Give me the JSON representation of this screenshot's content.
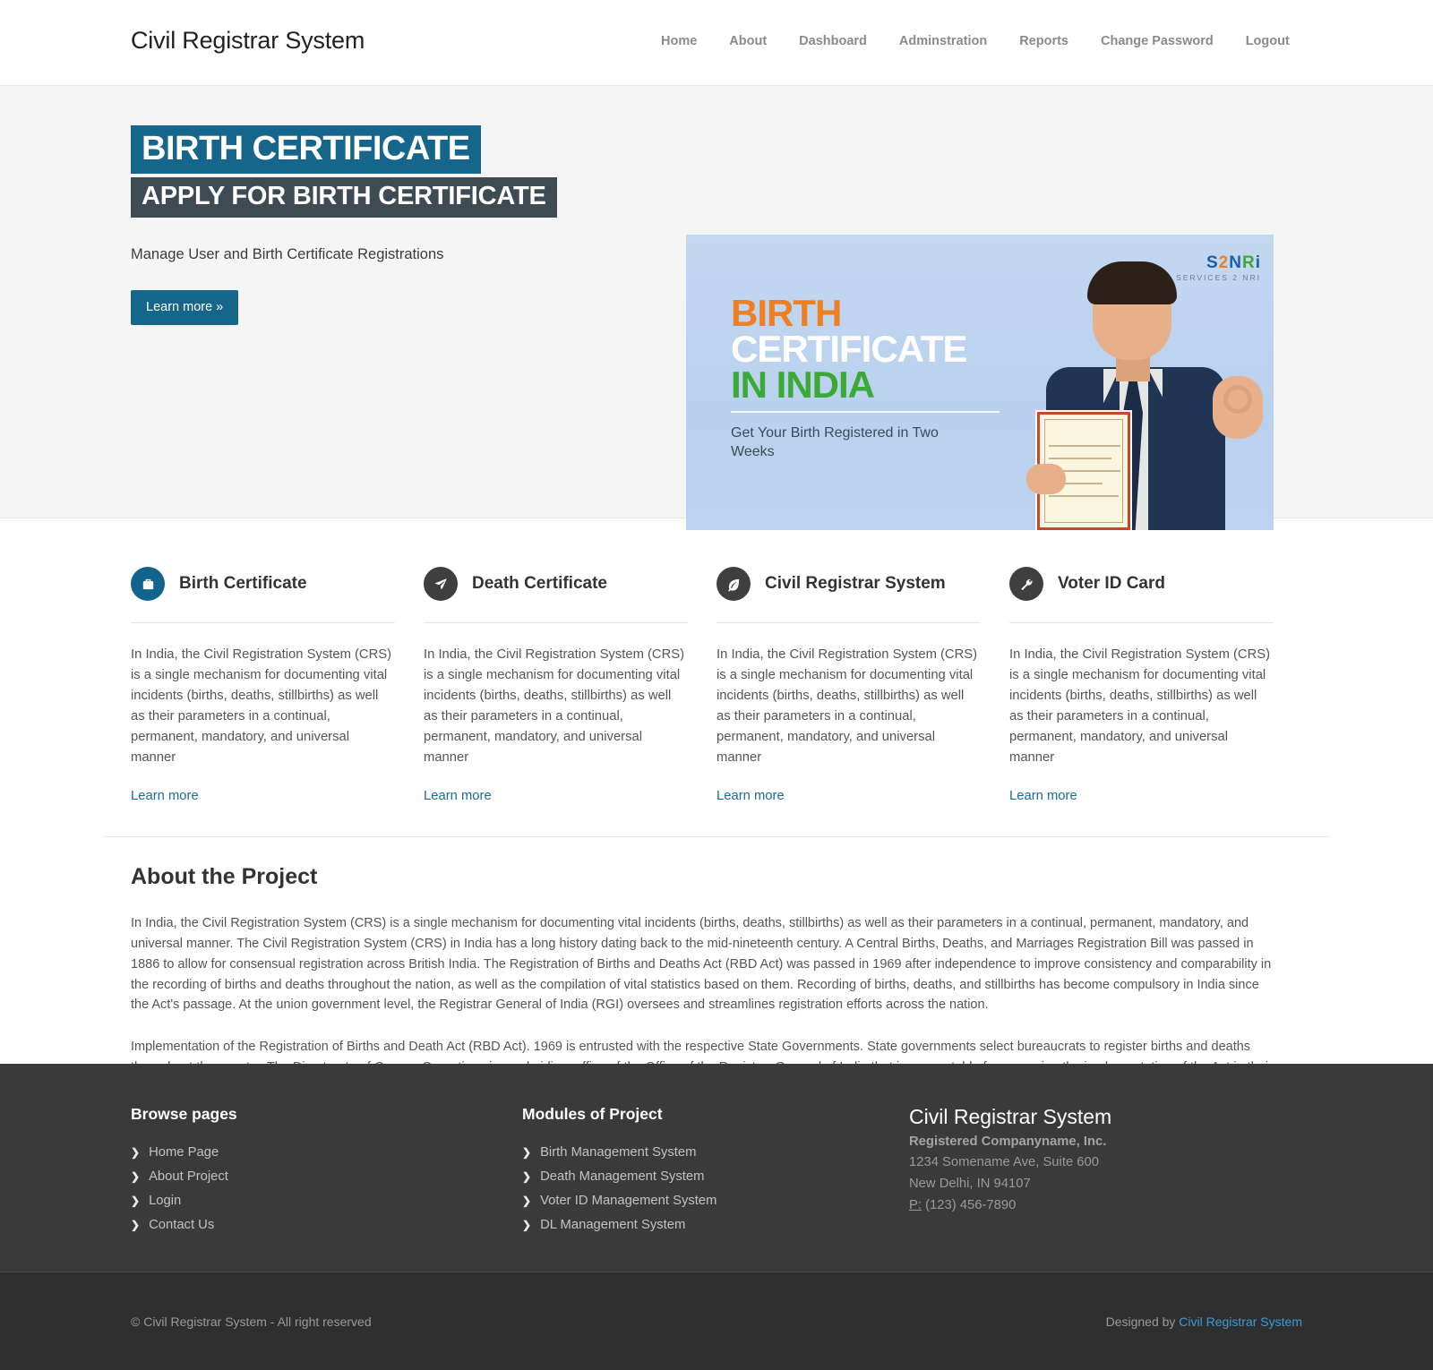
{
  "navbar": {
    "brand": "Civil Registrar System",
    "links": [
      {
        "label": "Home"
      },
      {
        "label": "About"
      },
      {
        "label": "Dashboard"
      },
      {
        "label": "Adminstration"
      },
      {
        "label": "Reports"
      },
      {
        "label": "Change Password"
      },
      {
        "label": "Logout"
      }
    ]
  },
  "hero": {
    "headline": "BIRTH CERTIFICATE",
    "subheadline": "APPLY FOR BIRTH CERTIFICATE",
    "description": "Manage User and Birth Certificate Registrations",
    "button_label": "Learn more »",
    "banner": {
      "logo_s": "S",
      "logo_2": "2",
      "logo_n": "N",
      "logo_r": "R",
      "logo_i": "i",
      "logo_sub": "SERVICES 2 NRI",
      "line1": "BIRTH",
      "line2": "CERTIFICATE",
      "line3": "IN INDIA",
      "tagline": "Get Your Birth Registered in Two Weeks"
    }
  },
  "features": {
    "body_text": "In India, the Civil Registration System (CRS) is a single mechanism for documenting vital incidents (births, deaths, stillbirths) as well as their parameters in a continual, permanent, mandatory, and universal manner",
    "link_label": "Learn more",
    "cards": [
      {
        "title": "Birth Certificate",
        "icon": "briefcase-icon",
        "accent": "#12638d"
      },
      {
        "title": "Death Certificate",
        "icon": "paper-plane-icon",
        "accent": "#3f3f3f"
      },
      {
        "title": "Civil Registrar System",
        "icon": "leaf-icon",
        "accent": "#3f3f3f"
      },
      {
        "title": "Voter ID Card",
        "icon": "wrench-icon",
        "accent": "#3f3f3f"
      }
    ]
  },
  "about": {
    "title": "About the Project",
    "paragraph1": "In India, the Civil Registration System (CRS) is a single mechanism for documenting vital incidents (births, deaths, stillbirths) as well as their parameters in a continual, permanent, mandatory, and universal manner. The Civil Registration System (CRS) in India has a long history dating back to the mid-nineteenth century. A Central Births, Deaths, and Marriages Registration Bill was passed in 1886 to allow for consensual registration across British India. The Registration of Births and Deaths Act (RBD Act) was passed in 1969 after independence to improve consistency and comparability in the recording of births and deaths throughout the nation, as well as the compilation of vital statistics based on them. Recording of births, deaths, and stillbirths has become compulsory in India since the Act's passage. At the union government level, the Registrar General of India (RGI) oversees and streamlines registration efforts across the nation.",
    "paragraph2": "Implementation of the Registration of Births and Death Act (RBD Act). 1969 is entrusted with the respective State Governments. State governments select bureaucrats to register births and deaths throughout the country. The Directorate of Census Operations is a subsidiary office of the Office of the Registrar General of India that is accountable for managing the implementation of the Act in their respective State/UT. The Act requires that all states use the same birth and death recording forms and certificates."
  },
  "footer": {
    "browse": {
      "title": "Browse pages",
      "items": [
        {
          "label": "Home Page"
        },
        {
          "label": "About Project"
        },
        {
          "label": "Login"
        },
        {
          "label": "Contact Us"
        }
      ]
    },
    "modules": {
      "title": "Modules of Project",
      "items": [
        {
          "label": "Birth Management System"
        },
        {
          "label": "Death Management System"
        },
        {
          "label": "Voter ID Management System"
        },
        {
          "label": "DL Management System"
        }
      ]
    },
    "company": {
      "brand": "Civil Registrar System",
      "registered": "Registered Companyname, Inc.",
      "address1": "1234 Somename Ave, Suite 600",
      "address2": "New Delhi, IN 94107",
      "phone_label": "P:",
      "phone": "(123) 456-7890"
    },
    "bottom": {
      "copyright": "© Civil Registrar System - All right reserved",
      "designed_prefix": "Designed by ",
      "designed_link": "Civil Registrar System"
    }
  }
}
